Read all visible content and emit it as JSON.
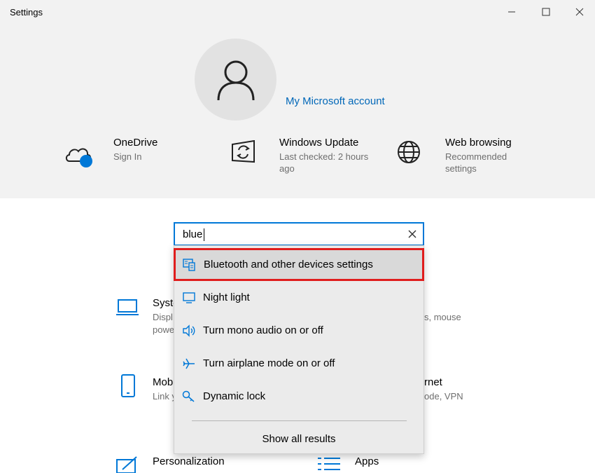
{
  "window": {
    "title": "Settings",
    "controls": {
      "minimize_icon": "minimize-icon",
      "maximize_icon": "maximize-icon",
      "close_icon": "close-icon"
    }
  },
  "account": {
    "avatar_icon": "person-icon",
    "link": "My Microsoft account"
  },
  "quick_tiles": [
    {
      "name": "OneDrive",
      "subtitle": "Sign In",
      "icon": "onedrive-cloud-icon"
    },
    {
      "name": "Windows Update",
      "subtitle": "Last checked: 2 hours ago",
      "icon": "windows-update-icon"
    },
    {
      "name": "Web browsing",
      "subtitle": "Recommended settings",
      "icon": "globe-icon"
    }
  ],
  "search": {
    "value": "blue",
    "clear_icon": "close-icon"
  },
  "suggestions": {
    "items": [
      {
        "label": "Bluetooth and other devices settings",
        "icon": "bluetooth-devices-icon",
        "selected": true
      },
      {
        "label": "Night light",
        "icon": "monitor-icon",
        "selected": false
      },
      {
        "label": "Turn mono audio on or off",
        "icon": "speaker-icon",
        "selected": false
      },
      {
        "label": "Turn airplane mode on or off",
        "icon": "airplane-icon",
        "selected": false
      },
      {
        "label": "Dynamic lock",
        "icon": "key-icon",
        "selected": false
      }
    ],
    "show_all": "Show all results"
  },
  "categories_partial": {
    "system_name": "Syste",
    "system_sub1": "Displ",
    "system_sub2": "powe",
    "devices_sub": "s, mouse",
    "mobile_name": "Mob",
    "mobile_sub": "Link y",
    "network_name": "rnet",
    "network_sub": "ode, VPN",
    "personalization_name": "Personalization",
    "apps_name": "Apps"
  },
  "colors": {
    "accent": "#0078d7",
    "link": "#0067b8",
    "highlight_border": "#e01d1d"
  }
}
